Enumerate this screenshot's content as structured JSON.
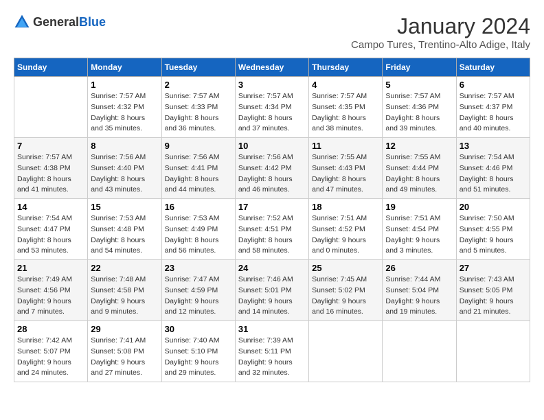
{
  "logo": {
    "text_general": "General",
    "text_blue": "Blue"
  },
  "title": "January 2024",
  "subtitle": "Campo Tures, Trentino-Alto Adige, Italy",
  "days_of_week": [
    "Sunday",
    "Monday",
    "Tuesday",
    "Wednesday",
    "Thursday",
    "Friday",
    "Saturday"
  ],
  "weeks": [
    [
      {
        "day": "",
        "sunrise": "",
        "sunset": "",
        "daylight": ""
      },
      {
        "day": "1",
        "sunrise": "Sunrise: 7:57 AM",
        "sunset": "Sunset: 4:32 PM",
        "daylight": "Daylight: 8 hours and 35 minutes."
      },
      {
        "day": "2",
        "sunrise": "Sunrise: 7:57 AM",
        "sunset": "Sunset: 4:33 PM",
        "daylight": "Daylight: 8 hours and 36 minutes."
      },
      {
        "day": "3",
        "sunrise": "Sunrise: 7:57 AM",
        "sunset": "Sunset: 4:34 PM",
        "daylight": "Daylight: 8 hours and 37 minutes."
      },
      {
        "day": "4",
        "sunrise": "Sunrise: 7:57 AM",
        "sunset": "Sunset: 4:35 PM",
        "daylight": "Daylight: 8 hours and 38 minutes."
      },
      {
        "day": "5",
        "sunrise": "Sunrise: 7:57 AM",
        "sunset": "Sunset: 4:36 PM",
        "daylight": "Daylight: 8 hours and 39 minutes."
      },
      {
        "day": "6",
        "sunrise": "Sunrise: 7:57 AM",
        "sunset": "Sunset: 4:37 PM",
        "daylight": "Daylight: 8 hours and 40 minutes."
      }
    ],
    [
      {
        "day": "7",
        "sunrise": "Sunrise: 7:57 AM",
        "sunset": "Sunset: 4:38 PM",
        "daylight": "Daylight: 8 hours and 41 minutes."
      },
      {
        "day": "8",
        "sunrise": "Sunrise: 7:56 AM",
        "sunset": "Sunset: 4:40 PM",
        "daylight": "Daylight: 8 hours and 43 minutes."
      },
      {
        "day": "9",
        "sunrise": "Sunrise: 7:56 AM",
        "sunset": "Sunset: 4:41 PM",
        "daylight": "Daylight: 8 hours and 44 minutes."
      },
      {
        "day": "10",
        "sunrise": "Sunrise: 7:56 AM",
        "sunset": "Sunset: 4:42 PM",
        "daylight": "Daylight: 8 hours and 46 minutes."
      },
      {
        "day": "11",
        "sunrise": "Sunrise: 7:55 AM",
        "sunset": "Sunset: 4:43 PM",
        "daylight": "Daylight: 8 hours and 47 minutes."
      },
      {
        "day": "12",
        "sunrise": "Sunrise: 7:55 AM",
        "sunset": "Sunset: 4:44 PM",
        "daylight": "Daylight: 8 hours and 49 minutes."
      },
      {
        "day": "13",
        "sunrise": "Sunrise: 7:54 AM",
        "sunset": "Sunset: 4:46 PM",
        "daylight": "Daylight: 8 hours and 51 minutes."
      }
    ],
    [
      {
        "day": "14",
        "sunrise": "Sunrise: 7:54 AM",
        "sunset": "Sunset: 4:47 PM",
        "daylight": "Daylight: 8 hours and 53 minutes."
      },
      {
        "day": "15",
        "sunrise": "Sunrise: 7:53 AM",
        "sunset": "Sunset: 4:48 PM",
        "daylight": "Daylight: 8 hours and 54 minutes."
      },
      {
        "day": "16",
        "sunrise": "Sunrise: 7:53 AM",
        "sunset": "Sunset: 4:49 PM",
        "daylight": "Daylight: 8 hours and 56 minutes."
      },
      {
        "day": "17",
        "sunrise": "Sunrise: 7:52 AM",
        "sunset": "Sunset: 4:51 PM",
        "daylight": "Daylight: 8 hours and 58 minutes."
      },
      {
        "day": "18",
        "sunrise": "Sunrise: 7:51 AM",
        "sunset": "Sunset: 4:52 PM",
        "daylight": "Daylight: 9 hours and 0 minutes."
      },
      {
        "day": "19",
        "sunrise": "Sunrise: 7:51 AM",
        "sunset": "Sunset: 4:54 PM",
        "daylight": "Daylight: 9 hours and 3 minutes."
      },
      {
        "day": "20",
        "sunrise": "Sunrise: 7:50 AM",
        "sunset": "Sunset: 4:55 PM",
        "daylight": "Daylight: 9 hours and 5 minutes."
      }
    ],
    [
      {
        "day": "21",
        "sunrise": "Sunrise: 7:49 AM",
        "sunset": "Sunset: 4:56 PM",
        "daylight": "Daylight: 9 hours and 7 minutes."
      },
      {
        "day": "22",
        "sunrise": "Sunrise: 7:48 AM",
        "sunset": "Sunset: 4:58 PM",
        "daylight": "Daylight: 9 hours and 9 minutes."
      },
      {
        "day": "23",
        "sunrise": "Sunrise: 7:47 AM",
        "sunset": "Sunset: 4:59 PM",
        "daylight": "Daylight: 9 hours and 12 minutes."
      },
      {
        "day": "24",
        "sunrise": "Sunrise: 7:46 AM",
        "sunset": "Sunset: 5:01 PM",
        "daylight": "Daylight: 9 hours and 14 minutes."
      },
      {
        "day": "25",
        "sunrise": "Sunrise: 7:45 AM",
        "sunset": "Sunset: 5:02 PM",
        "daylight": "Daylight: 9 hours and 16 minutes."
      },
      {
        "day": "26",
        "sunrise": "Sunrise: 7:44 AM",
        "sunset": "Sunset: 5:04 PM",
        "daylight": "Daylight: 9 hours and 19 minutes."
      },
      {
        "day": "27",
        "sunrise": "Sunrise: 7:43 AM",
        "sunset": "Sunset: 5:05 PM",
        "daylight": "Daylight: 9 hours and 21 minutes."
      }
    ],
    [
      {
        "day": "28",
        "sunrise": "Sunrise: 7:42 AM",
        "sunset": "Sunset: 5:07 PM",
        "daylight": "Daylight: 9 hours and 24 minutes."
      },
      {
        "day": "29",
        "sunrise": "Sunrise: 7:41 AM",
        "sunset": "Sunset: 5:08 PM",
        "daylight": "Daylight: 9 hours and 27 minutes."
      },
      {
        "day": "30",
        "sunrise": "Sunrise: 7:40 AM",
        "sunset": "Sunset: 5:10 PM",
        "daylight": "Daylight: 9 hours and 29 minutes."
      },
      {
        "day": "31",
        "sunrise": "Sunrise: 7:39 AM",
        "sunset": "Sunset: 5:11 PM",
        "daylight": "Daylight: 9 hours and 32 minutes."
      },
      {
        "day": "",
        "sunrise": "",
        "sunset": "",
        "daylight": ""
      },
      {
        "day": "",
        "sunrise": "",
        "sunset": "",
        "daylight": ""
      },
      {
        "day": "",
        "sunrise": "",
        "sunset": "",
        "daylight": ""
      }
    ]
  ]
}
